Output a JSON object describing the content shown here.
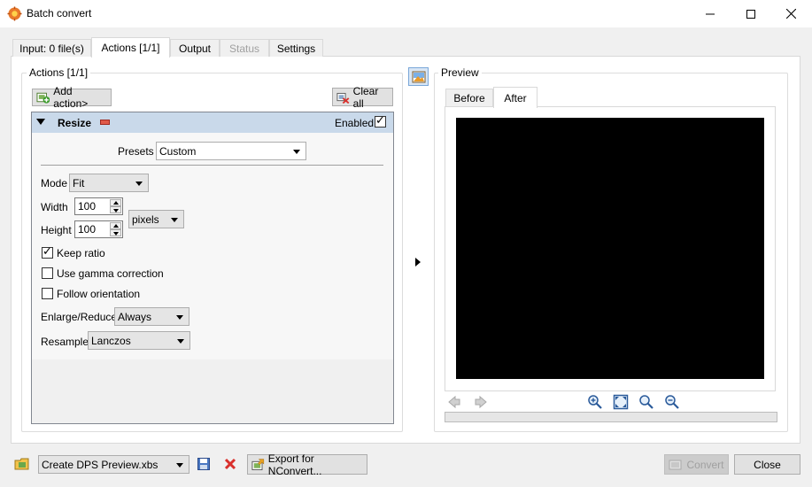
{
  "window": {
    "title": "Batch convert"
  },
  "tabs": [
    {
      "label": "Input: 0 file(s)",
      "active": false,
      "disabled": false
    },
    {
      "label": "Actions [1/1]",
      "active": true,
      "disabled": false
    },
    {
      "label": "Output",
      "active": false,
      "disabled": false
    },
    {
      "label": "Status",
      "active": false,
      "disabled": true
    },
    {
      "label": "Settings",
      "active": false,
      "disabled": false
    }
  ],
  "actions_group": {
    "title": "Actions [1/1]",
    "add_action_label": "Add action>",
    "clear_all_label": "Clear all"
  },
  "resize": {
    "header": "Resize",
    "enabled_label": "Enabled",
    "enabled": true,
    "presets_label": "Presets",
    "presets_value": "Custom",
    "mode_label": "Mode",
    "mode_value": "Fit",
    "width_label": "Width",
    "width_value": "100",
    "height_label": "Height",
    "height_value": "100",
    "units_value": "pixels",
    "keep_ratio_label": "Keep ratio",
    "keep_ratio": true,
    "gamma_label": "Use gamma correction",
    "gamma": false,
    "orientation_label": "Follow orientation",
    "orientation": false,
    "enlarge_label": "Enlarge/Reduce",
    "enlarge_value": "Always",
    "resample_label": "Resample",
    "resample_value": "Lanczos"
  },
  "preview": {
    "title": "Preview",
    "tabs": [
      {
        "label": "Before",
        "active": false
      },
      {
        "label": "After",
        "active": true
      }
    ],
    "canvas_color": "#000000"
  },
  "footer": {
    "script_value": "Create DPS Preview.xbs",
    "export_label": "Export for NConvert...",
    "convert_label": "Convert",
    "close_label": "Close"
  },
  "colors": {
    "accent_header": "#c9d9ea",
    "delete_red": "#d9302c"
  }
}
